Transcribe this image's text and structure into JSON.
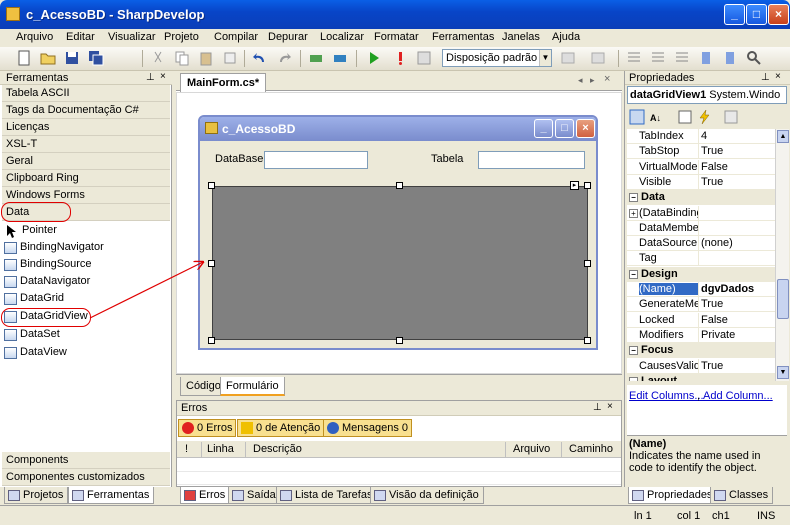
{
  "window": {
    "title": "c_AcessoBD - SharpDevelop"
  },
  "menu": [
    "Arquivo",
    "Editar",
    "Visualizar",
    "Projeto",
    "Compilar",
    "Depurar",
    "Localizar",
    "Formatar",
    "Ferramentas",
    "Janelas",
    "Ajuda"
  ],
  "toolbar": {
    "layout_value": "Disposição padrão"
  },
  "tools_panel": {
    "title": "Ferramentas",
    "categories": [
      "Tabela ASCII",
      "Tags da Documentação C#",
      "Licenças",
      "XSL-T",
      "Geral",
      "Clipboard Ring",
      "Windows Forms",
      "Data"
    ],
    "items": [
      "Pointer",
      "BindingNavigator",
      "BindingSource",
      "DataNavigator",
      "DataGrid",
      "DataGridView",
      "DataSet",
      "DataView"
    ],
    "bottom_categories": [
      "Components",
      "Componentes customizados"
    ]
  },
  "document": {
    "tab": "MainForm.cs*",
    "form_title": "c_AcessoBD",
    "label_database": "DataBase",
    "label_table": "Tabela",
    "bottom_tabs": [
      "Código",
      "Formulário"
    ]
  },
  "errors_panel": {
    "title": "Erros",
    "errors_btn": "0 Erros",
    "warnings_btn": "0 de Atenção",
    "messages_btn": "Mensagens 0",
    "columns": [
      "!",
      "Linha",
      "Descrição",
      "Arquivo",
      "Caminho"
    ]
  },
  "dock_tabs_left": [
    "Projetos",
    "Ferramentas"
  ],
  "dock_tabs_center": [
    "Erros",
    "Saída",
    "Lista de Tarefas",
    "Visão da definição"
  ],
  "dock_tabs_right": [
    "Propriedades",
    "Classes"
  ],
  "properties": {
    "title": "Propriedades",
    "object": "dataGridView1",
    "object_type": "System.Windo",
    "rows": [
      {
        "kind": "prop",
        "name": "TabIndex",
        "value": "4"
      },
      {
        "kind": "prop",
        "name": "TabStop",
        "value": "True"
      },
      {
        "kind": "prop",
        "name": "VirtualMode",
        "value": "False"
      },
      {
        "kind": "prop",
        "name": "Visible",
        "value": "True"
      },
      {
        "kind": "cat",
        "name": "Data"
      },
      {
        "kind": "prop",
        "name": "(DataBinding",
        "value": "",
        "expandable": true
      },
      {
        "kind": "prop",
        "name": "DataMember",
        "value": ""
      },
      {
        "kind": "prop",
        "name": "DataSource",
        "value": "(none)"
      },
      {
        "kind": "prop",
        "name": "Tag",
        "value": ""
      },
      {
        "kind": "cat",
        "name": "Design"
      },
      {
        "kind": "prop",
        "name": "(Name)",
        "value": "dgvDados",
        "selected": true
      },
      {
        "kind": "prop",
        "name": "GenerateMer",
        "value": "True"
      },
      {
        "kind": "prop",
        "name": "Locked",
        "value": "False"
      },
      {
        "kind": "prop",
        "name": "Modifiers",
        "value": "Private"
      },
      {
        "kind": "cat",
        "name": "Focus"
      },
      {
        "kind": "prop",
        "name": "CausesValida",
        "value": "True"
      },
      {
        "kind": "cat",
        "name": "Layout"
      }
    ],
    "verb_edit_columns": "Edit Columns...",
    "verb_add_column": "Add Column...",
    "desc_title": "(Name)",
    "desc_text": "Indicates the name used in code to identify the object."
  },
  "status": {
    "line": "ln 1",
    "col": "col 1",
    "ch": "ch1",
    "ins": "INS"
  },
  "colors": {
    "annotation": "#e00000",
    "selection": "#316ac5",
    "xp_blue": "#0A5FE6"
  }
}
